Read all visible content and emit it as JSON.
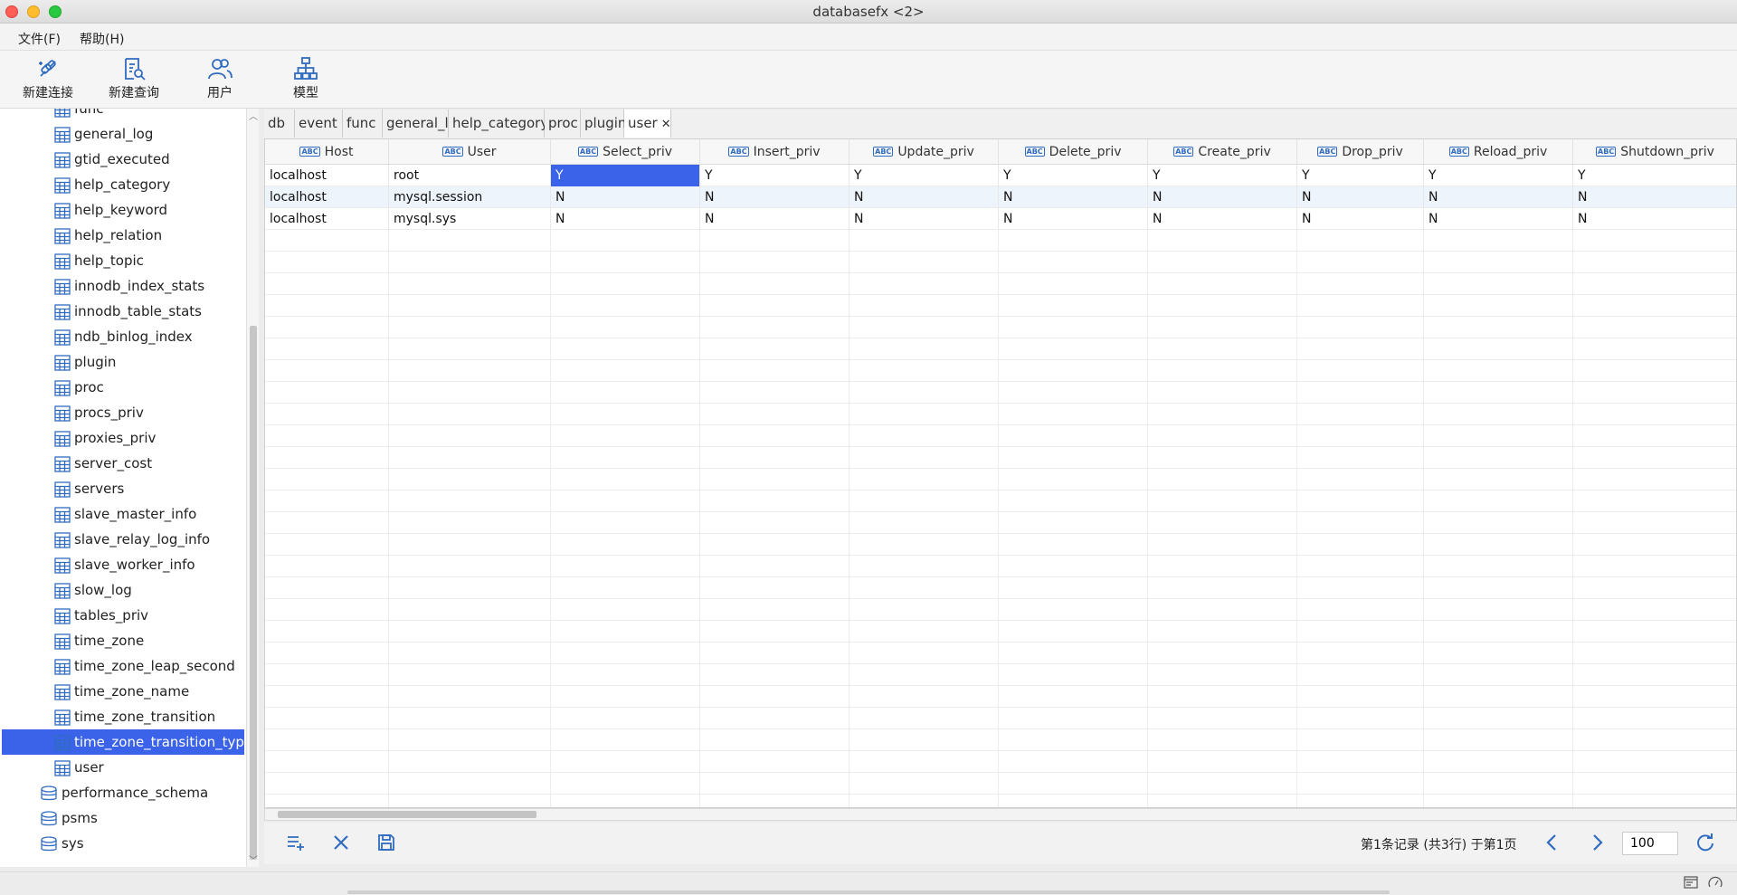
{
  "window": {
    "title": "databasefx <2>"
  },
  "menu": [
    {
      "label": "文件(F)"
    },
    {
      "label": "帮助(H)"
    }
  ],
  "toolbar": [
    {
      "label": "新建连接",
      "icon": "new-connection-icon"
    },
    {
      "label": "新建查询",
      "icon": "new-query-icon"
    },
    {
      "label": "用户",
      "icon": "users-icon"
    },
    {
      "label": "模型",
      "icon": "model-icon"
    }
  ],
  "sidebar": {
    "tables": [
      "func",
      "general_log",
      "gtid_executed",
      "help_category",
      "help_keyword",
      "help_relation",
      "help_topic",
      "innodb_index_stats",
      "innodb_table_stats",
      "ndb_binlog_index",
      "plugin",
      "proc",
      "procs_priv",
      "proxies_priv",
      "server_cost",
      "servers",
      "slave_master_info",
      "slave_relay_log_info",
      "slave_worker_info",
      "slow_log",
      "tables_priv",
      "time_zone",
      "time_zone_leap_second",
      "time_zone_name",
      "time_zone_transition",
      "time_zone_transition_type",
      "user"
    ],
    "selected_table": "time_zone_transition_type",
    "databases": [
      "performance_schema",
      "psms",
      "sys"
    ]
  },
  "tabs": [
    {
      "label": "db"
    },
    {
      "label": "event"
    },
    {
      "label": "func"
    },
    {
      "label": "general_log"
    },
    {
      "label": "help_category"
    },
    {
      "label": "proc"
    },
    {
      "label": "plugin"
    },
    {
      "label": "user",
      "active": true,
      "close": "✕"
    }
  ],
  "grid": {
    "columns": [
      "Host",
      "User",
      "Select_priv",
      "Insert_priv",
      "Update_priv",
      "Delete_priv",
      "Create_priv",
      "Drop_priv",
      "Reload_priv",
      "Shutdown_priv"
    ],
    "column_type_badge": "ABC",
    "rows": [
      [
        "localhost",
        "root",
        "Y",
        "Y",
        "Y",
        "Y",
        "Y",
        "Y",
        "Y",
        "Y"
      ],
      [
        "localhost",
        "mysql.session",
        "N",
        "N",
        "N",
        "N",
        "N",
        "N",
        "N",
        "N"
      ],
      [
        "localhost",
        "mysql.sys",
        "N",
        "N",
        "N",
        "N",
        "N",
        "N",
        "N",
        "N"
      ]
    ],
    "selected_cell": {
      "row": 0,
      "column": "Select_priv"
    }
  },
  "pagination": {
    "status": "第1条记录 (共3行) 于第1页",
    "page_size": "100"
  },
  "colors": {
    "selection": "#3b63ea",
    "accent_icon": "#2f6bc0",
    "close_light": "#fe5f57",
    "min_light": "#febc2e",
    "max_light": "#28c840"
  }
}
